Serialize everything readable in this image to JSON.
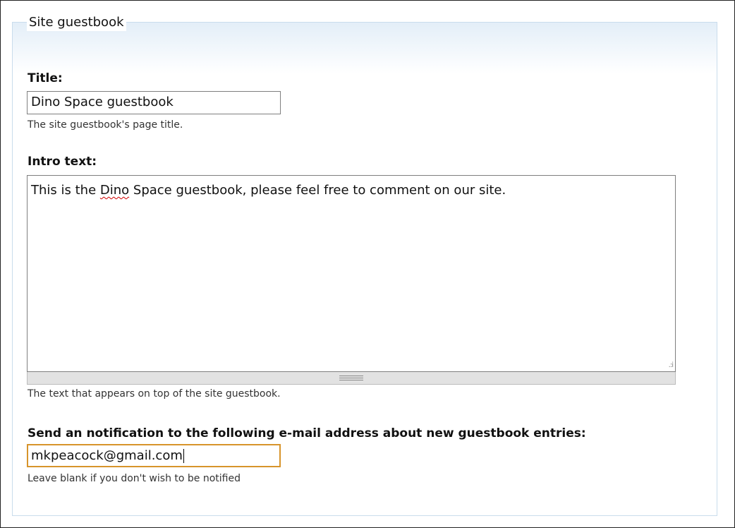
{
  "fieldset": {
    "legend": "Site guestbook"
  },
  "title_field": {
    "label": "Title:",
    "value": "Dino Space guestbook",
    "description": "The site guestbook's page title."
  },
  "intro_field": {
    "label": "Intro text:",
    "value_before": "This is the ",
    "value_misspelled": "Dino",
    "value_after": " Space guestbook, please feel free to comment on our site.",
    "description": "The text that appears on top of the site guestbook."
  },
  "email_field": {
    "label": "Send an notification to the following e-mail address about new guestbook entries:",
    "value": "mkpeacock@gmail.com",
    "description": "Leave blank if you don't wish to be notified"
  },
  "colors": {
    "focus_border": "#d7942b",
    "fieldset_border": "#c9dcec",
    "spellcheck_underline": "#d00000"
  }
}
